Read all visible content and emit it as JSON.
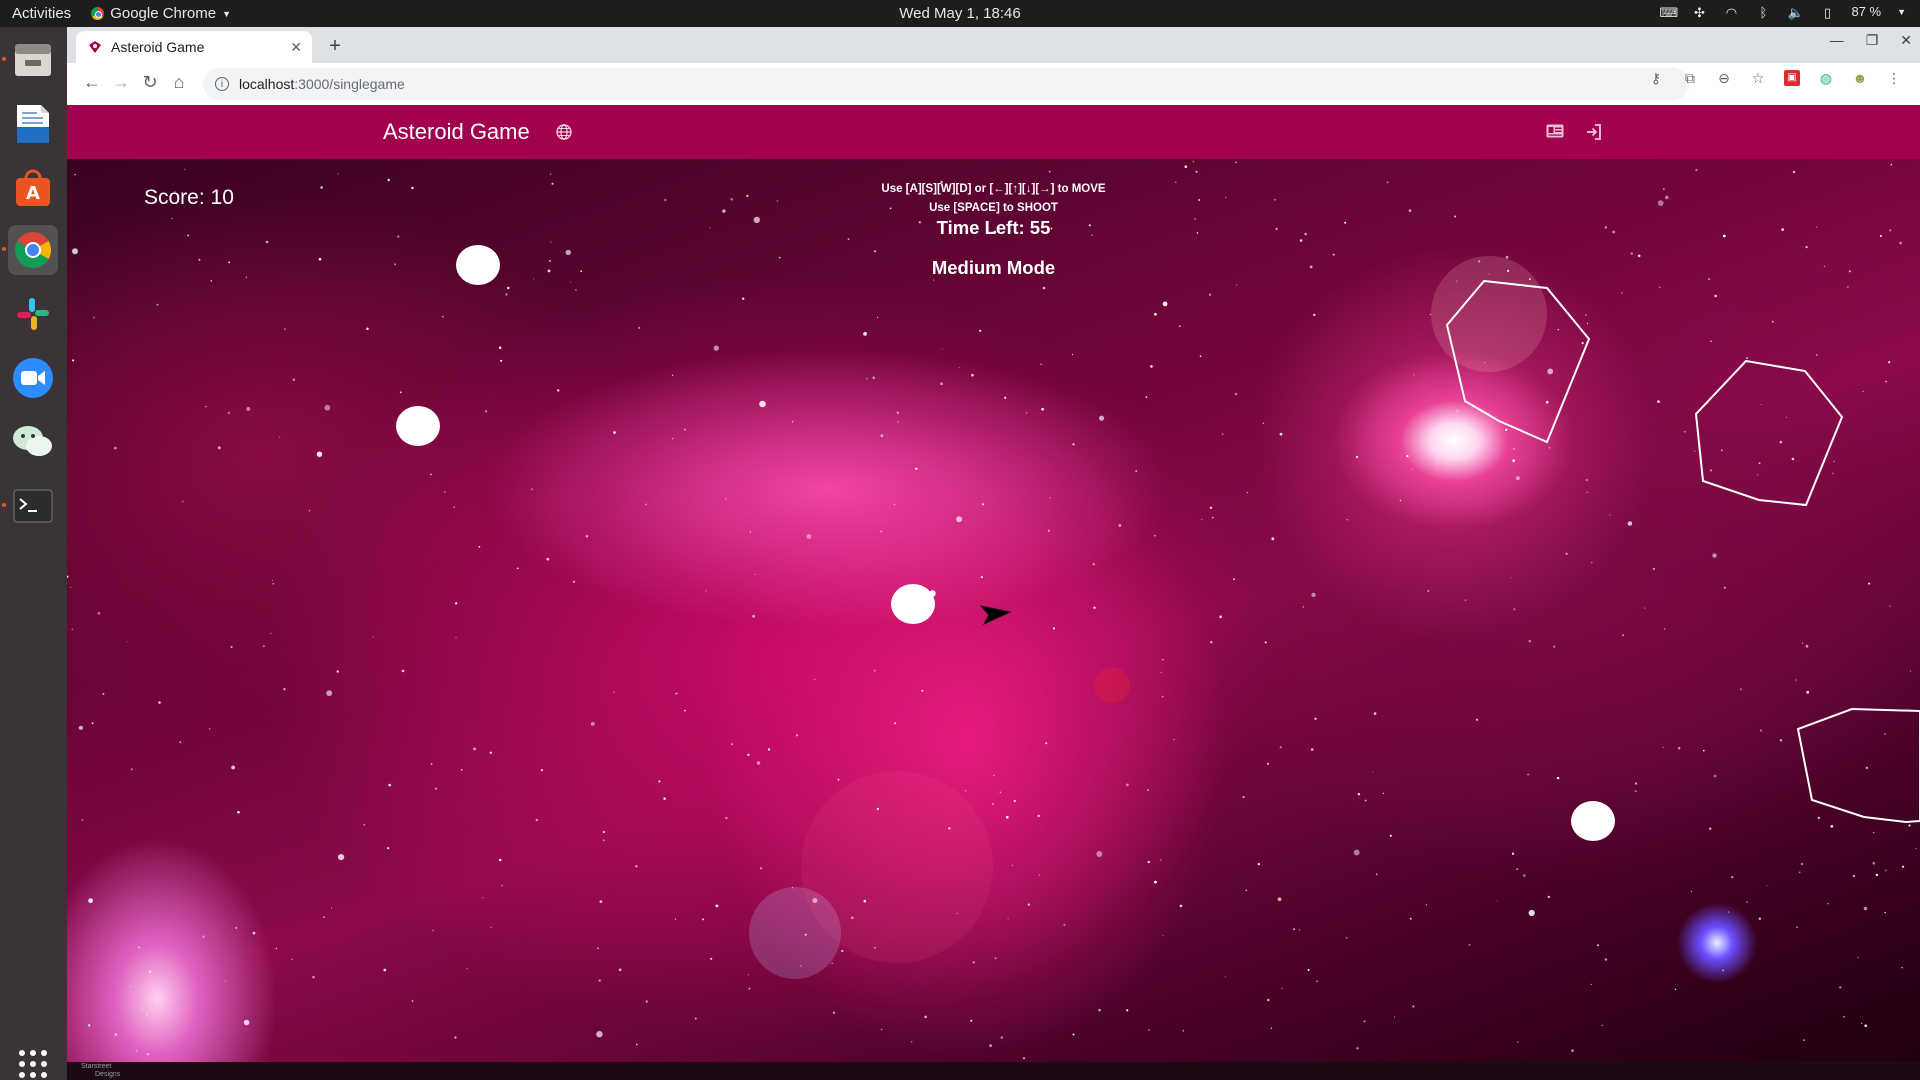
{
  "system_bar": {
    "activities": "Activities",
    "app_name": "Google Chrome",
    "clock": "Wed May  1, 18:46",
    "battery": "87 %"
  },
  "browser": {
    "tab_title": "Asteroid Game",
    "url_host": "localhost",
    "url_path": ":3000/singlegame"
  },
  "app": {
    "brand": "Asteroid Game",
    "accent_color": "#a3004e"
  },
  "game": {
    "score_text": "Score: 10",
    "move_hint": "Use [A][S][W][D] or [←][↑][↓][→] to MOVE",
    "shoot_hint": "Use [SPACE] to SHOOT",
    "time_left_text": "Time Left: 55",
    "mode_text": "Medium Mode"
  },
  "footer": {
    "logo_line1": "Starstreet",
    "logo_line2": "Designs"
  },
  "icons": {
    "dock": [
      "files-icon",
      "writer-icon",
      "software-center-icon",
      "chrome-icon",
      "slack-icon",
      "zoom-icon",
      "wechat-icon",
      "terminal-icon",
      "app-grid-icon"
    ],
    "navbar": [
      "globe-icon",
      "id-card-icon",
      "sign-in-icon"
    ]
  }
}
